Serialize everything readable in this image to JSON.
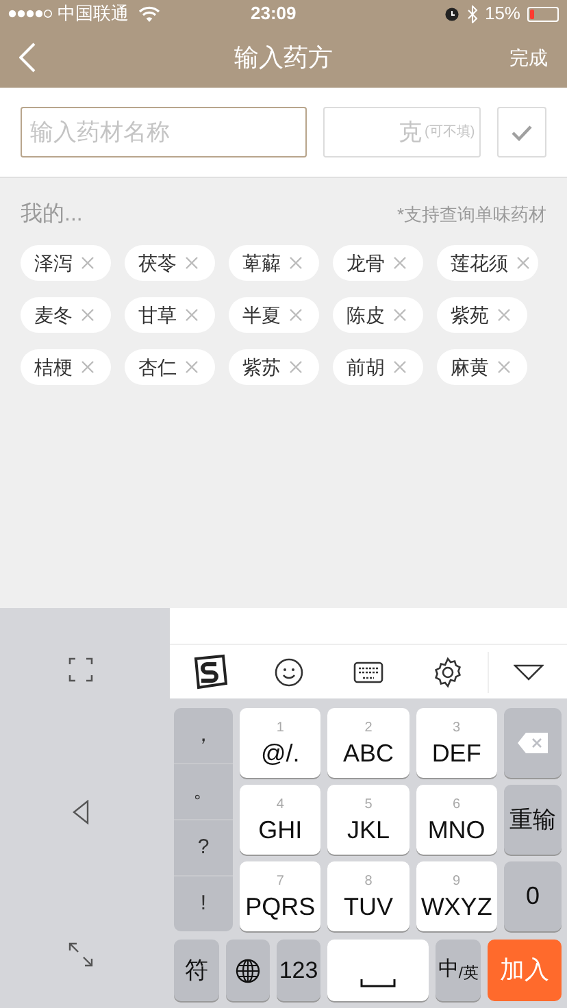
{
  "status_bar": {
    "carrier": "中国联通",
    "time": "23:09",
    "battery": "15%"
  },
  "nav": {
    "title": "输入药方",
    "action": "完成"
  },
  "form": {
    "name_field": {
      "placeholder": "输入药材名称"
    },
    "weight_field": {
      "unit": "克",
      "hint": "(可不填)"
    }
  },
  "section": {
    "label": "我的...",
    "note": "*支持查询单味药材"
  },
  "herbs": [
    "泽泻",
    "茯苓",
    "萆薢",
    "龙骨",
    "莲花须",
    "麦冬",
    "甘草",
    "半夏",
    "陈皮",
    "紫苑",
    "桔梗",
    "杏仁",
    "紫苏",
    "前胡",
    "麻黄"
  ],
  "keyboard": {
    "punctuation": [
      "，",
      "。",
      "?",
      "!"
    ],
    "keys": [
      {
        "digit": "1",
        "letters": "@/."
      },
      {
        "digit": "2",
        "letters": "ABC"
      },
      {
        "digit": "3",
        "letters": "DEF"
      },
      {
        "digit": "4",
        "letters": "GHI"
      },
      {
        "digit": "5",
        "letters": "JKL"
      },
      {
        "digit": "6",
        "letters": "MNO"
      },
      {
        "digit": "7",
        "letters": "PQRS"
      },
      {
        "digit": "8",
        "letters": "TUV"
      },
      {
        "digit": "9",
        "letters": "WXYZ"
      }
    ],
    "reset": "重输",
    "zero": "0",
    "symbols": "符",
    "numbers": "123",
    "language": "中$_{/英}$",
    "submit": "加入"
  }
}
